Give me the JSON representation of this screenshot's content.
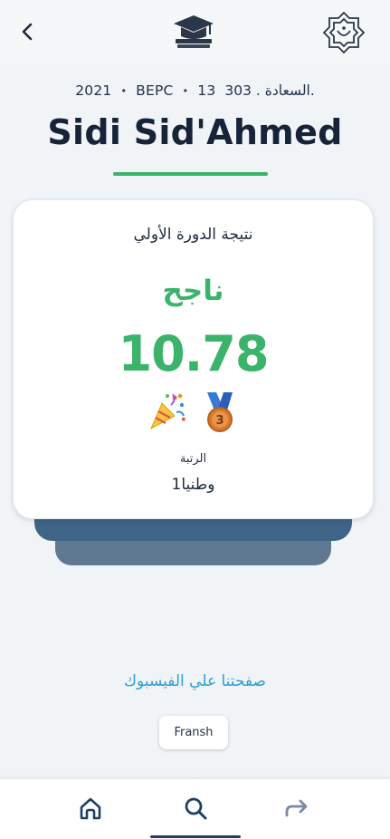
{
  "header": {
    "back_icon": "chevron-left-icon",
    "center_icon": "graduation-cap-icon",
    "right_icon": "national-emblem-icon"
  },
  "student": {
    "year": "2021",
    "exam": "BEPC",
    "number": "13",
    "center": "303 . السعادة.",
    "separator": "•",
    "name": "Sidi Sid'Ahmed"
  },
  "result_card": {
    "title": "نتيجة الدورة الأولي",
    "status": "ناجح",
    "score": "10.78",
    "icons": [
      "party-popper-icon",
      "third-place-medal-icon"
    ],
    "rank_label": "الرتبة",
    "rank_value": "وطنيا1"
  },
  "footer": {
    "facebook_link": "صفحتنا علي الفيسبوك",
    "language_button": "Fransh"
  },
  "bottom_nav": {
    "items": [
      {
        "icon": "home-icon"
      },
      {
        "icon": "search-icon",
        "active": true
      },
      {
        "icon": "share-icon"
      }
    ]
  },
  "colors": {
    "success": "#3bb36a",
    "primary": "#1d3f66",
    "link": "#2a9fd6"
  }
}
